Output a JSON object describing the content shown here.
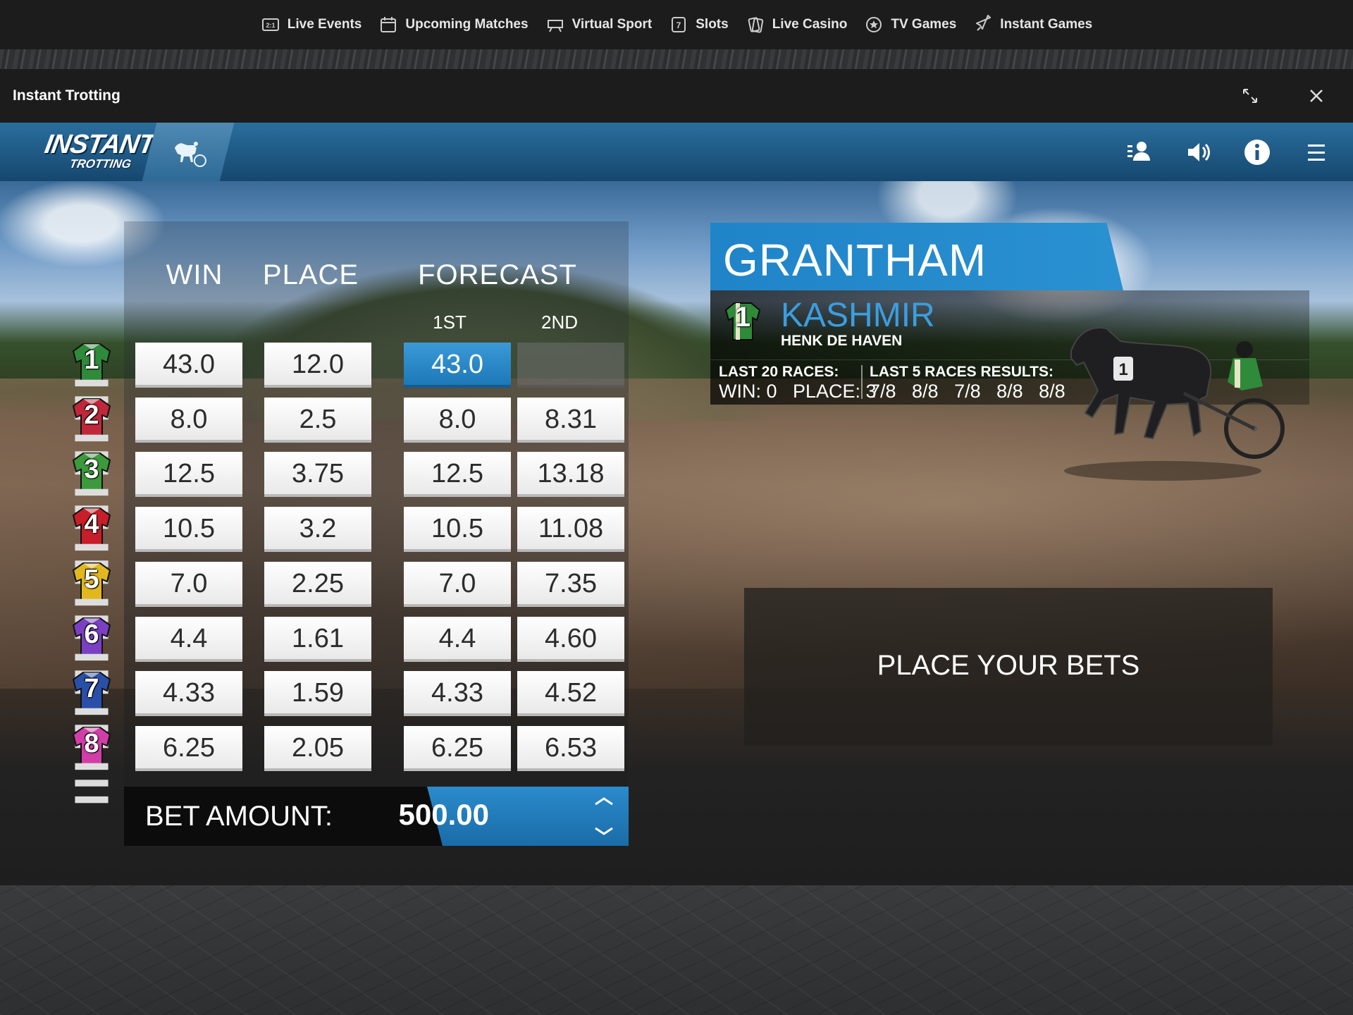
{
  "nav": {
    "items": [
      {
        "label": "Live Events",
        "icon": "live-events-icon"
      },
      {
        "label": "Upcoming Matches",
        "icon": "calendar-icon"
      },
      {
        "label": "Virtual Sport",
        "icon": "virtual-sport-icon"
      },
      {
        "label": "Slots",
        "icon": "slots-icon"
      },
      {
        "label": "Live Casino",
        "icon": "cards-icon"
      },
      {
        "label": "TV Games",
        "icon": "tv-games-icon"
      },
      {
        "label": "Instant Games",
        "icon": "rocket-icon"
      }
    ]
  },
  "window": {
    "title": "Instant Trotting"
  },
  "game": {
    "logo_line1": "INSTANT",
    "logo_line2": "TROTTING",
    "columns": {
      "win": "WIN",
      "place": "PLACE",
      "forecast": "FORECAST",
      "first": "1ST",
      "second": "2ND"
    },
    "runners": [
      {
        "number": "1",
        "win": "43.0",
        "place": "12.0",
        "fc1": "43.0",
        "fc2": "",
        "color": "#2f8a3a"
      },
      {
        "number": "2",
        "win": "8.0",
        "place": "2.5",
        "fc1": "8.0",
        "fc2": "8.31",
        "color": "#c0283a"
      },
      {
        "number": "3",
        "win": "12.5",
        "place": "3.75",
        "fc1": "12.5",
        "fc2": "13.18",
        "color": "#3c9a3c"
      },
      {
        "number": "4",
        "win": "10.5",
        "place": "3.2",
        "fc1": "10.5",
        "fc2": "11.08",
        "color": "#c81e2a"
      },
      {
        "number": "5",
        "win": "7.0",
        "place": "2.25",
        "fc1": "7.0",
        "fc2": "7.35",
        "color": "#e2b81e"
      },
      {
        "number": "6",
        "win": "4.4",
        "place": "1.61",
        "fc1": "4.4",
        "fc2": "4.60",
        "color": "#7b3fc4"
      },
      {
        "number": "7",
        "win": "4.33",
        "place": "1.59",
        "fc1": "4.33",
        "fc2": "4.52",
        "color": "#2a4fa8"
      },
      {
        "number": "8",
        "win": "6.25",
        "place": "2.05",
        "fc1": "6.25",
        "fc2": "6.53",
        "color": "#d23ea8"
      }
    ],
    "bet_label": "BET AMOUNT:",
    "bet_amount": "500.00",
    "track_name": "GRANTHAM MOOR",
    "horse": {
      "number": "1",
      "name": "KASHMIR",
      "jockey": "HENK DE HAVEN",
      "last20_title": "LAST 20 RACES:",
      "last20_value": "WIN: 0   PLACE: 3",
      "last5_title": "LAST 5 RACES RESULTS:",
      "last5_value": "7/8   8/8   7/8   8/8   8/8"
    },
    "status": "PLACE YOUR BETS"
  }
}
